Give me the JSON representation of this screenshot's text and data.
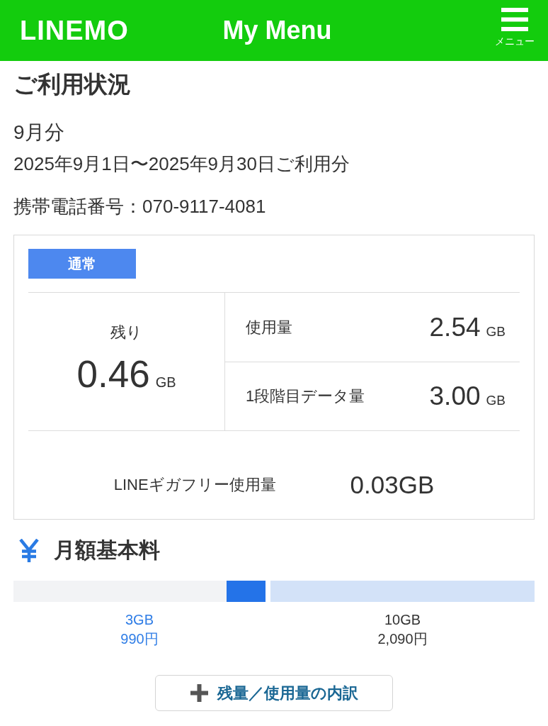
{
  "header": {
    "logo": "LINEMO",
    "title": "My Menu",
    "menu_label": "メニュー"
  },
  "usage": {
    "heading": "ご利用状況",
    "month": "9月分",
    "period": "2025年9月1日〜2025年9月30日ご利用分",
    "phone": "携帯電話番号：070-9117-4081"
  },
  "data_card": {
    "badge": "通常",
    "remaining": {
      "label": "残り",
      "value": "0.46",
      "unit": "GB"
    },
    "stats": [
      {
        "label": "使用量",
        "value": "2.54",
        "unit": "GB"
      },
      {
        "label": "1段階目データ量",
        "value": "3.00",
        "unit": "GB"
      }
    ],
    "giga_free": {
      "label": "LINEギガフリー使用量",
      "value": "0.03GB"
    }
  },
  "fee": {
    "heading": "月額基本料",
    "tiers": [
      {
        "size": "3GB",
        "price": "990円",
        "selected": true
      },
      {
        "size": "10GB",
        "price": "2,090円",
        "selected": false
      }
    ]
  },
  "breakdown_button": {
    "label": "残量／使用量の内訳"
  }
}
